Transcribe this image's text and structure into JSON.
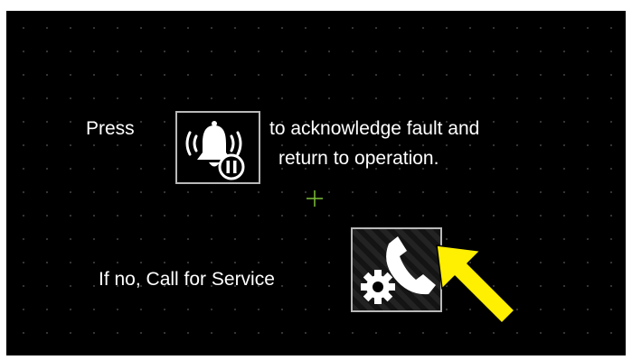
{
  "instructions": {
    "press_label": "Press",
    "acknowledge_line1": "to acknowledge fault and",
    "acknowledge_line2": "return to operation.",
    "call_service_label": "If no, Call for Service"
  },
  "icons": {
    "acknowledge": "alarm-bell-pause-icon",
    "service": "phone-gear-icon",
    "crosshair": "crosshair-icon",
    "pointer": "arrow-pointer-icon"
  },
  "colors": {
    "screen_background": "#000000",
    "text": "#ffffff",
    "button_border": "#b9b9b9",
    "crosshair": "#7dbf3a",
    "pointer_arrow": "#ffef00"
  }
}
